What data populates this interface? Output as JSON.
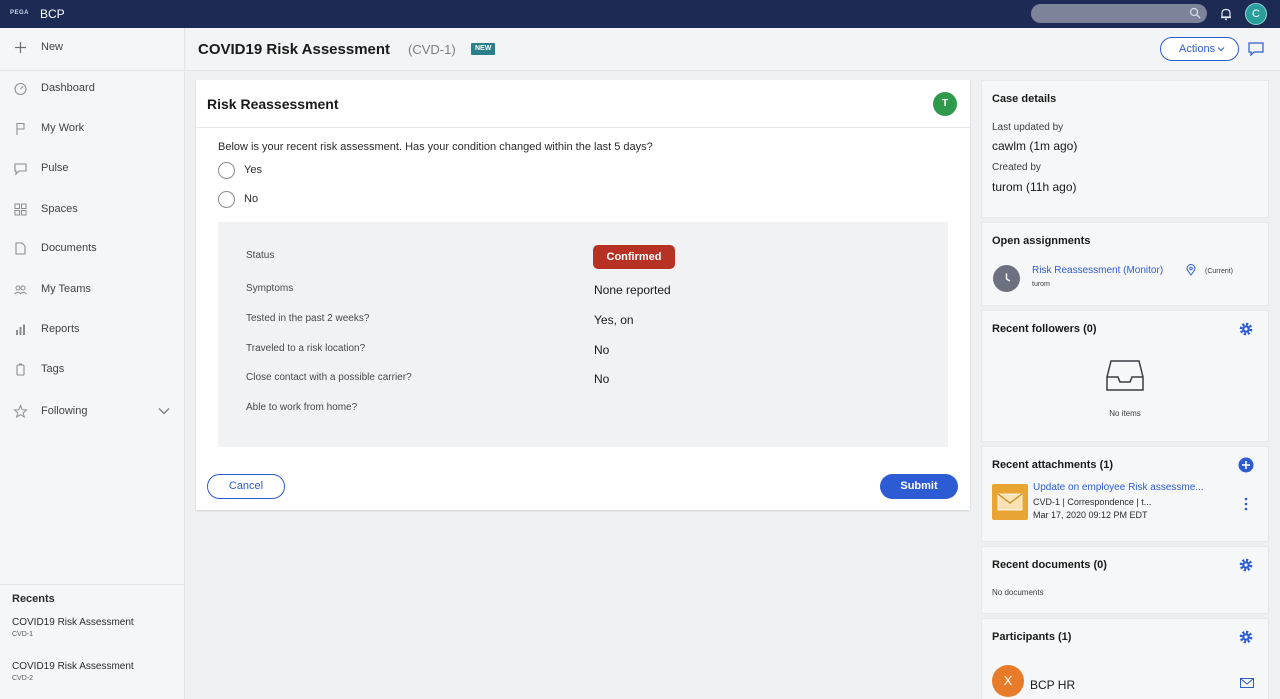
{
  "topbar": {
    "brand": "PEGA",
    "app_name": "BCP",
    "user_initial": "C",
    "bg_color": "#1c2a54"
  },
  "sidebar": {
    "new_label": "New",
    "items": [
      {
        "label": "Dashboard",
        "icon": "dashboard-icon"
      },
      {
        "label": "My Work",
        "icon": "flag-icon"
      },
      {
        "label": "Pulse",
        "icon": "chat-bubble-icon"
      },
      {
        "label": "Spaces",
        "icon": "spaces-grid-icon"
      },
      {
        "label": "Documents",
        "icon": "document-icon"
      },
      {
        "label": "My Teams",
        "icon": "team-icon"
      },
      {
        "label": "Reports",
        "icon": "bar-chart-icon"
      },
      {
        "label": "Tags",
        "icon": "tag-icon"
      },
      {
        "label": "Following",
        "icon": "star-icon"
      }
    ],
    "recents": {
      "title": "Recents",
      "items": [
        {
          "title": "COVID19 Risk Assessment",
          "id": "CVD-1"
        },
        {
          "title": "COVID19 Risk Assessment",
          "id": "CVD-2"
        }
      ]
    }
  },
  "header": {
    "title": "COVID19 Risk Assessment",
    "case_id": "(CVD-1)",
    "badge": "NEW",
    "actions_label": "Actions"
  },
  "form": {
    "title": "Risk Reassessment",
    "assignee_initial": "T",
    "question": "Below is your recent risk assessment. Has your condition changed within the last 5 days?",
    "options": [
      "Yes",
      "No"
    ],
    "summary": [
      {
        "label": "Status",
        "value": "Confirmed"
      },
      {
        "label": "Symptoms",
        "value": "None reported"
      },
      {
        "label": "Tested in the past 2 weeks?",
        "value": "Yes, on"
      },
      {
        "label": "Traveled to a risk location?",
        "value": "No"
      },
      {
        "label": "Close contact with a possible carrier?",
        "value": "No"
      },
      {
        "label": "Able to work from home?",
        "value": ""
      }
    ],
    "cancel_label": "Cancel",
    "submit_label": "Submit",
    "status_color": "#b83125",
    "accent_color": "#2c5bd4"
  },
  "case_details": {
    "title": "Case details",
    "last_updated_label": "Last updated by",
    "last_updated_value": "cawlm (1m ago)",
    "created_label": "Created by",
    "created_value": "turom (11h ago)"
  },
  "open_assignments": {
    "title": "Open assignments",
    "item_link": "Risk Reassessment (Monitor)",
    "item_tag": "(Current)",
    "item_user": "turom"
  },
  "recent_followers": {
    "title": "Recent followers (0)",
    "empty": "No items"
  },
  "recent_attachments": {
    "title": "Recent attachments (1)",
    "link": "Update on employee Risk assessme...",
    "meta": "CVD-1 | Correspondence | t...",
    "date": "Mar 17, 2020 09:12 PM EDT"
  },
  "recent_documents": {
    "title": "Recent documents (0)",
    "empty": "No documents"
  },
  "participants": {
    "title": "Participants (1)",
    "initial": "X",
    "name": "BCP HR"
  }
}
